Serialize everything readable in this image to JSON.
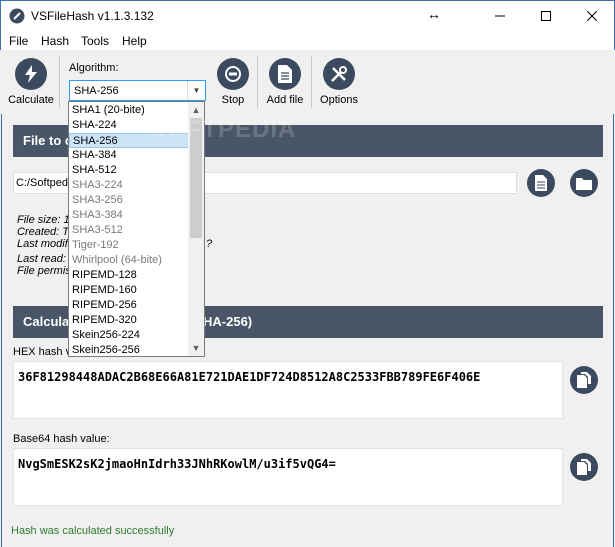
{
  "window": {
    "title": "VSFileHash v1.1.3.132",
    "resize_glyph": "↔"
  },
  "menu": [
    "File",
    "Hash",
    "Tools",
    "Help"
  ],
  "toolbar": {
    "calculate_label": "Calculate",
    "algorithm_label": "Algorithm:",
    "algorithm_value": "SHA-256",
    "stop_label": "Stop",
    "add_file_label": "Add file",
    "options_label": "Options"
  },
  "dropdown": {
    "items": [
      {
        "label": "SHA1 (20-bite)",
        "state": "normal"
      },
      {
        "label": "SHA-224",
        "state": "normal"
      },
      {
        "label": "SHA-256",
        "state": "selected"
      },
      {
        "label": "SHA-384",
        "state": "normal"
      },
      {
        "label": "SHA-512",
        "state": "normal"
      },
      {
        "label": "SHA3-224",
        "state": "disabled"
      },
      {
        "label": "SHA3-256",
        "state": "disabled"
      },
      {
        "label": "SHA3-384",
        "state": "disabled"
      },
      {
        "label": "SHA3-512",
        "state": "disabled"
      },
      {
        "label": "Tiger-192",
        "state": "disabled"
      },
      {
        "label": "Whirlpool (64-bite)",
        "state": "disabled"
      },
      {
        "label": "RIPEMD-128",
        "state": "normal"
      },
      {
        "label": "RIPEMD-160",
        "state": "normal"
      },
      {
        "label": "RIPEMD-256",
        "state": "normal"
      },
      {
        "label": "RIPEMD-320",
        "state": "normal"
      },
      {
        "label": "Skein256-224",
        "state": "normal"
      },
      {
        "label": "Skein256-256",
        "state": "normal"
      }
    ]
  },
  "file_section": {
    "header": "File to c",
    "path": "C:/Softped",
    "info": [
      "File size: 1",
      "Created: T",
      "Last modifi",
      "Last read:",
      "File permiss"
    ],
    "info_tail": "?"
  },
  "calc_section": {
    "header_left": "Calculat",
    "header_right": "HA-256)"
  },
  "hex": {
    "label": "HEX hash va",
    "value": "36F81298448ADAC2B68E66A81E721DAE1DF724D8512A8C2533FBB789FE6F406E"
  },
  "base64": {
    "label": "Base64 hash value:",
    "value": "NvgSmESK2sK2jmaoHnIdrh33JNhRKowlM/u3if5vQG4="
  },
  "status": "Hash was calculated successfully",
  "watermark": "SOFTPEDIA",
  "colors": {
    "header_bg": "#4a5668",
    "icon_bg": "#3b4a5e",
    "status_green": "#2e7d2e",
    "select_border": "#3399ff"
  }
}
